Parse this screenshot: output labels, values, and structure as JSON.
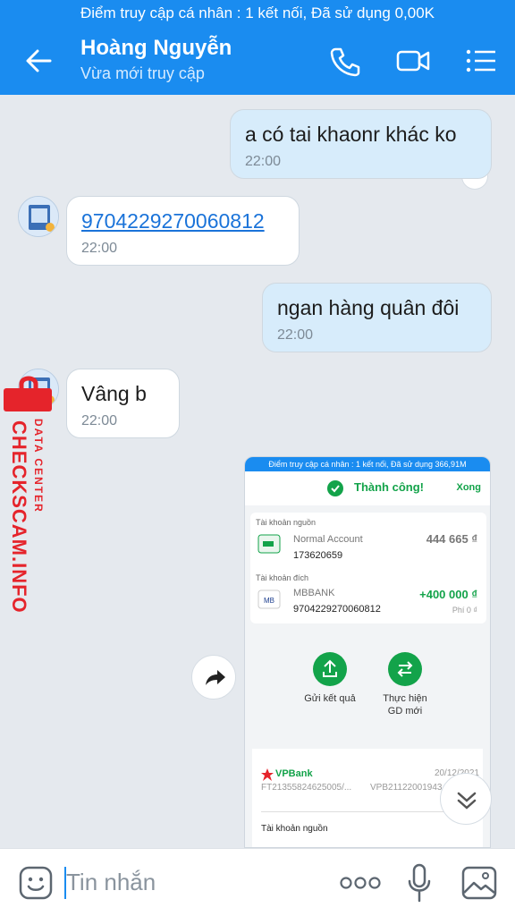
{
  "status_bar": {
    "text": "Điểm truy cập cá nhân : 1 kết nối, Đã sử dụng 0,00K"
  },
  "header": {
    "contact_name": "Hoàng Nguyễn",
    "status": "Vừa mới truy cập"
  },
  "messages": [
    {
      "text": "a có tai khaonr khác ko",
      "time": "22:00",
      "direction": "out"
    },
    {
      "text": "9704229270060812",
      "time": "22:00",
      "direction": "in",
      "is_link": true
    },
    {
      "text": "ngan hàng quân đôi",
      "time": "22:00",
      "direction": "out"
    },
    {
      "text": "Vâng b",
      "time": "22:00",
      "direction": "in"
    }
  ],
  "watermark": {
    "main": "CHECKSCAM.INFO",
    "sub": "DATA CENTER"
  },
  "shared_screenshot": {
    "status_text": "Điểm truy cập cá nhân : 1 kết nối, Đã sử dụng 366,91M",
    "result": "Thành công!",
    "done": "Xong",
    "source_label": "Tài khoản nguồn",
    "source_name": "Normal Account",
    "source_number": "173620659",
    "source_amount": "444 665 ₫",
    "dest_label": "Tài khoản đích",
    "dest_bank": "MBBANK",
    "dest_number": "9704229270060812",
    "dest_amount": "+400 000 ₫",
    "fee": "Phí 0 ₫",
    "action_send": "Gửi kết quả",
    "action_new_1": "Thực hiện",
    "action_new_2": "GD mới",
    "bank_logo": "VPBank",
    "receipt_date": "20/12/2021",
    "receipt_ref1": "FT21355824625005/...",
    "receipt_ref2": "VPB21122001943",
    "receipt_source": "Tài khoản nguồn"
  },
  "input": {
    "placeholder": "Tin nhắn"
  },
  "colors": {
    "accent": "#1a8cf0",
    "success": "#13a34a",
    "out_bubble": "#d7ecfb",
    "watermark": "#e5242b"
  }
}
